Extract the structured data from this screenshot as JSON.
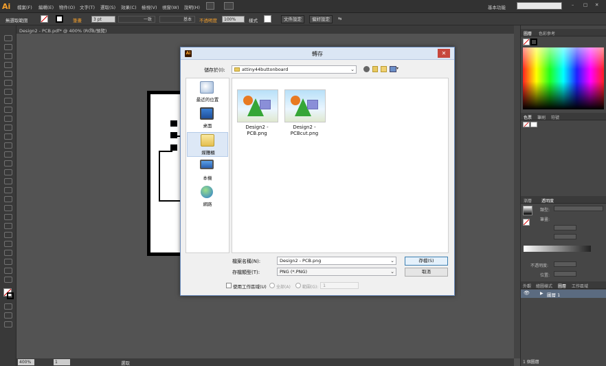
{
  "app": {
    "logo": "Ai",
    "menus": [
      "檔案(F)",
      "編輯(E)",
      "物件(O)",
      "文字(T)",
      "選取(S)",
      "效果(C)",
      "檢視(V)",
      "視窗(W)",
      "說明(H)"
    ],
    "workspace": "基本功能",
    "search_placeholder": ""
  },
  "control_bar": {
    "selection": "無選取範圍",
    "stroke_label": "筆畫",
    "stroke_value": "3 pt",
    "profile_label": "一致",
    "brush_label": "基本",
    "opacity_label": "不透明度",
    "opacity_value": "100%",
    "style_label": "樣式",
    "doc_setup": "文件設定",
    "prefs": "偏好設定"
  },
  "document": {
    "tab_title": "Design2 - PCB.pdf* @ 400% (RGB/預覽)",
    "zoom": "400%",
    "page": "1",
    "status": "選取"
  },
  "right_panel": {
    "color_tabs": [
      "圖層",
      "色彩參考"
    ],
    "swatch_tabs": [
      "色票",
      "筆刷",
      "符號"
    ],
    "gradient_tabs": [
      "漸層",
      "透明度"
    ],
    "gradient_type_label": "類型:",
    "stroke_label": "筆畫:",
    "angle_label": "",
    "opacity_label": "不透明度:",
    "position_label": "位置:",
    "layers_tabs": [
      "外觀",
      "繪圖樣式",
      "圖層",
      "工作區域"
    ],
    "layer_name": "圖層 1",
    "layer_count": "1 個圖層"
  },
  "dialog": {
    "title": "轉存",
    "save_in_label": "儲存於(I):",
    "save_in_value": "attiny44buttonboard",
    "places": [
      {
        "label": "最近的位置",
        "icon": "recent-places-icon"
      },
      {
        "label": "桌面",
        "icon": "desktop-icon"
      },
      {
        "label": "媒體櫃",
        "icon": "libraries-icon"
      },
      {
        "label": "本機",
        "icon": "computer-icon"
      },
      {
        "label": "網路",
        "icon": "network-icon"
      }
    ],
    "files": [
      {
        "name": "Design2 - PCB.png"
      },
      {
        "name": "Design2 - PCBcut.png"
      }
    ],
    "filename_label": "檔案名稱(N):",
    "filename_value": "Design2 - PCB.png",
    "filetype_label": "存檔類型(T):",
    "filetype_value": "PNG (*.PNG)",
    "save_button": "存檔(S)",
    "cancel_button": "取消",
    "use_artboards_label": "使用工作區域(U)",
    "all_label": "全部(A)",
    "range_label": "範圍(G):",
    "range_value": "1"
  }
}
